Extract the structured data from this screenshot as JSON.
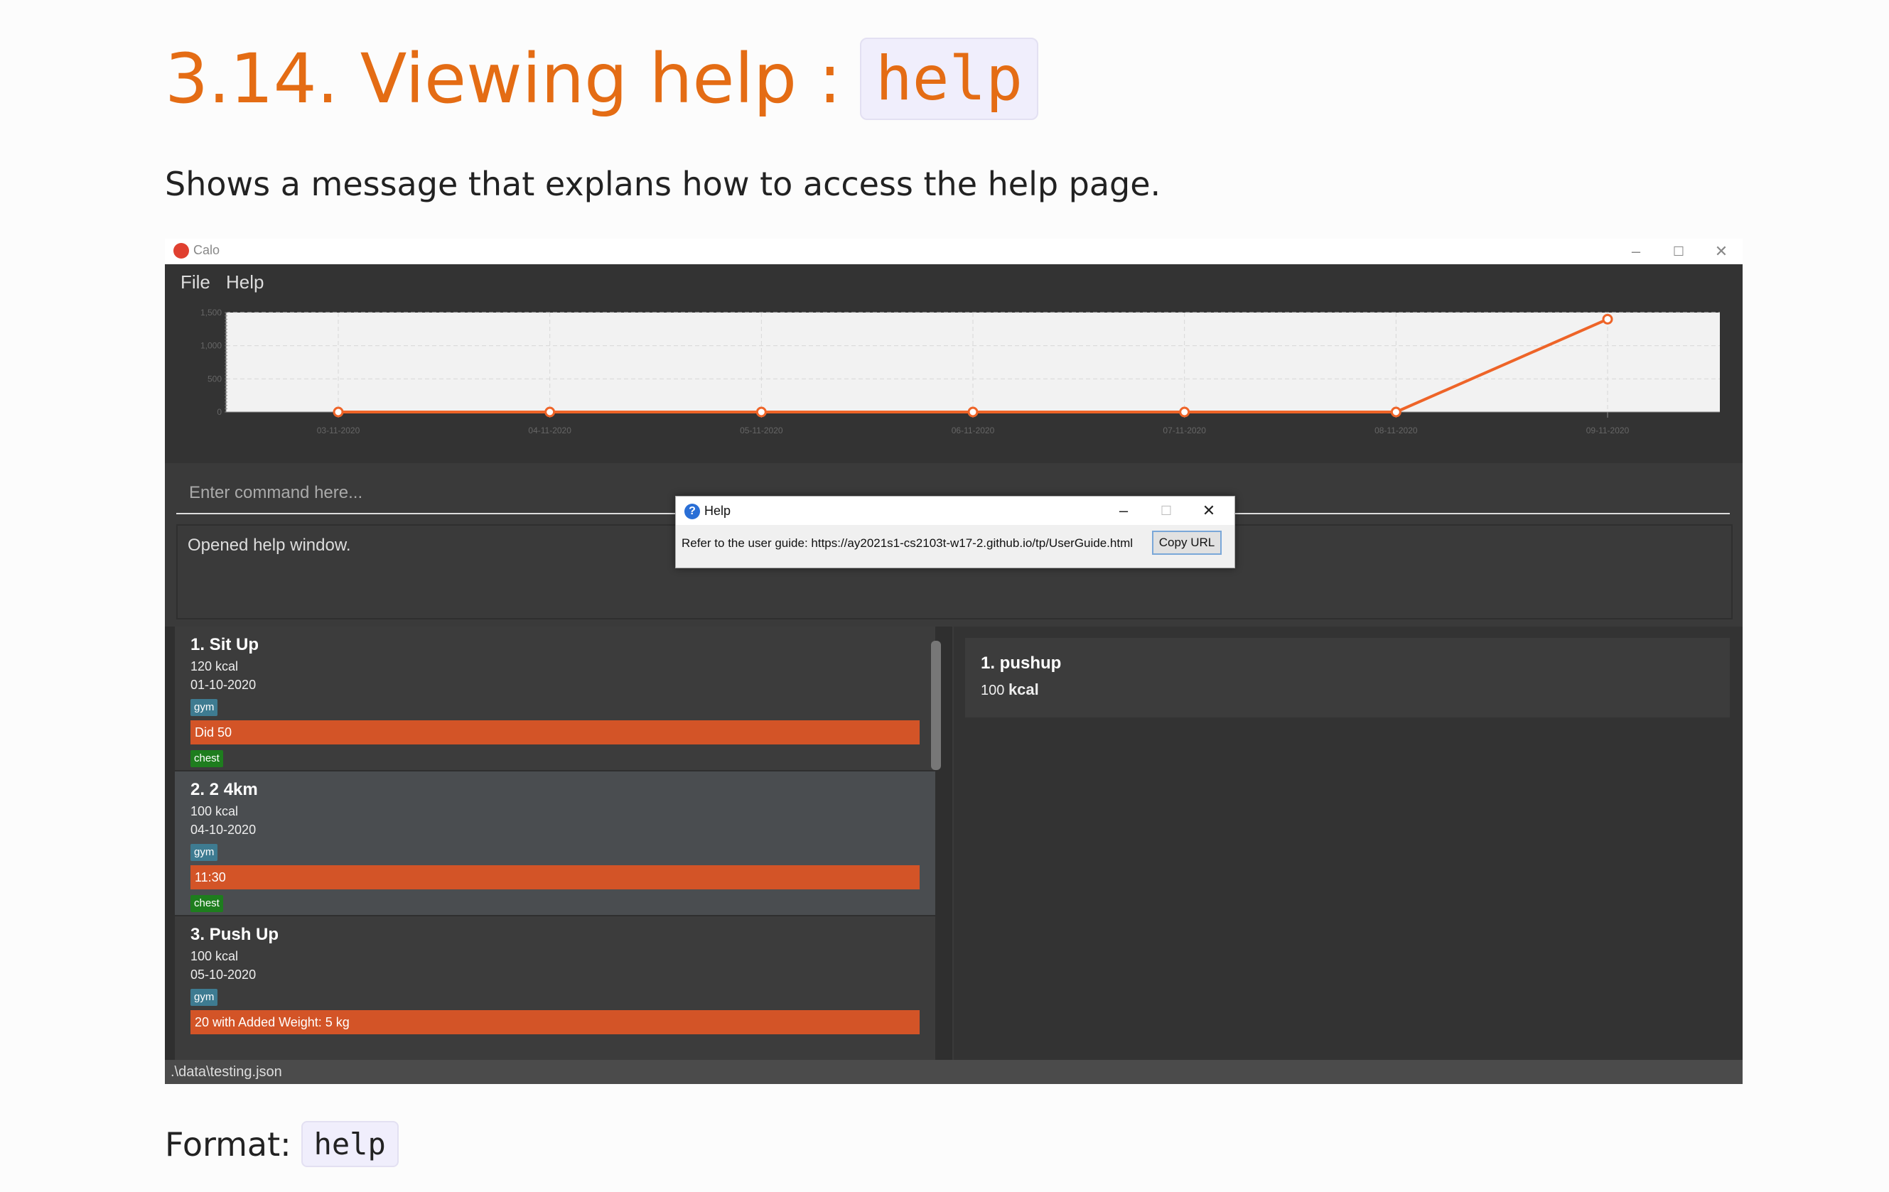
{
  "doc": {
    "heading_text": "3.14. Viewing help :",
    "heading_code": "help",
    "description": "Shows a message that explans how to access the help page.",
    "format_label": "Format:",
    "format_code": "help"
  },
  "window": {
    "title": "Calo",
    "controls": {
      "minimize": "–",
      "maximize": "☐",
      "close": "✕"
    }
  },
  "menu": {
    "file": "File",
    "help": "Help"
  },
  "chart_data": {
    "type": "line",
    "x": [
      "03-11-2020",
      "04-11-2020",
      "05-11-2020",
      "06-11-2020",
      "07-11-2020",
      "08-11-2020",
      "09-11-2020"
    ],
    "series": [
      {
        "values": [
          0,
          0,
          0,
          0,
          0,
          0,
          1400
        ]
      }
    ],
    "yticks": [
      "0",
      "500",
      "1,000",
      "1,500"
    ],
    "ylim": [
      0,
      1500
    ],
    "grid": true,
    "colors": {
      "line": "#ee6428"
    }
  },
  "command": {
    "placeholder": "Enter command here..."
  },
  "result": {
    "text": "Opened help window."
  },
  "exercises": [
    {
      "index_name": "1.  Sit Up",
      "calories": "120  kcal",
      "date": "01-10-2020",
      "tag": "gym",
      "remark": "Did 50",
      "muscle": "chest"
    },
    {
      "index_name": "2.  2 4km",
      "calories": "100  kcal",
      "date": "04-10-2020",
      "tag": "gym",
      "remark": "11:30",
      "muscle": "chest"
    },
    {
      "index_name": "3.  Push Up",
      "calories": "100  kcal",
      "date": "05-10-2020",
      "tag": "gym",
      "remark": "20 with Added Weight: 5 kg"
    }
  ],
  "summary": {
    "index_name": "1.  pushup",
    "amount": "100",
    "unit": "kcal"
  },
  "status": {
    "path": ".\\data\\testing.json"
  },
  "help_dialog": {
    "title": "Help",
    "icon": "?",
    "message": "Refer to the user guide: https://ay2021s1-cs2103t-w17-2.github.io/tp/UserGuide.html",
    "copy_button": "Copy URL",
    "controls": {
      "minimize": "–",
      "maximize": "☐",
      "close": "✕"
    }
  }
}
